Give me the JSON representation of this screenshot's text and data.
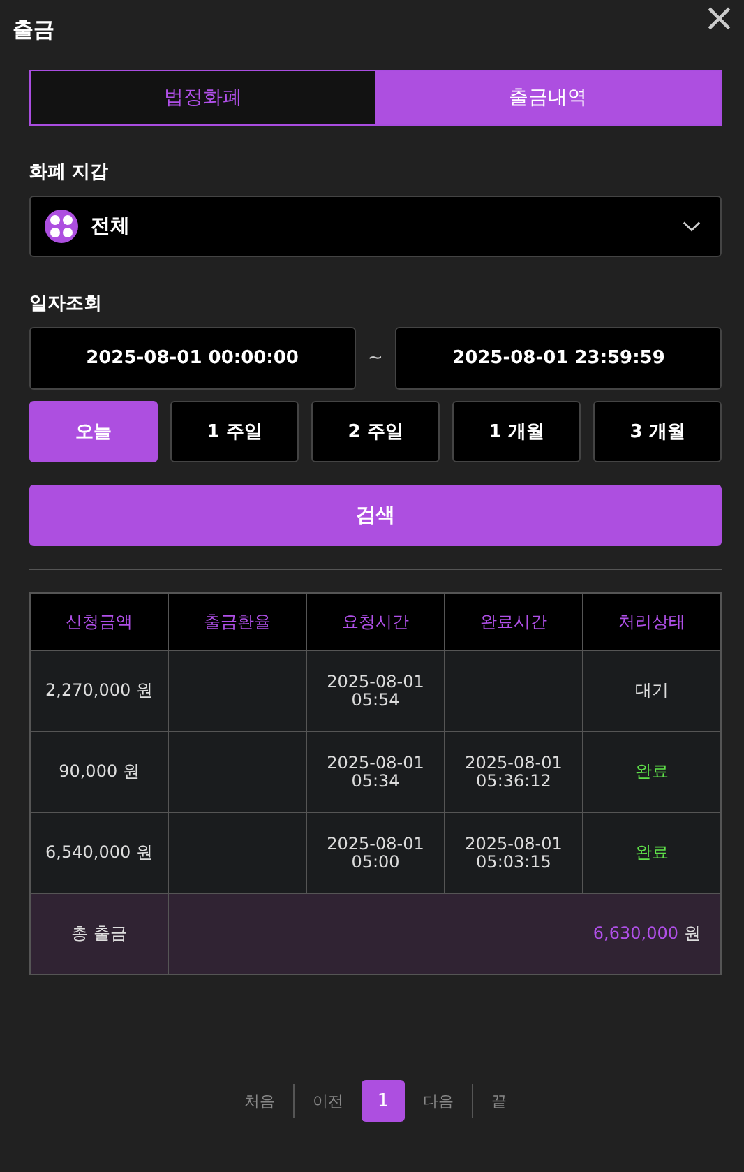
{
  "window": {
    "title": "출금",
    "close": "×"
  },
  "tabs": [
    {
      "label": "법정화폐",
      "selected": false
    },
    {
      "label": "출금내역",
      "selected": true
    }
  ],
  "wallet": {
    "label": "화폐 지갑",
    "value": "전체"
  },
  "date_range": {
    "label": "일자조회",
    "start": "2025-08-01 00:00:00",
    "separator": "~",
    "end": "2025-08-01 23:59:59"
  },
  "periods": [
    {
      "label": "오늘",
      "selected": true
    },
    {
      "label": "1 주일",
      "selected": false
    },
    {
      "label": "2 주일",
      "selected": false
    },
    {
      "label": "1 개월",
      "selected": false
    },
    {
      "label": "3 개월",
      "selected": false
    }
  ],
  "search_button": "검색",
  "table": {
    "columns": [
      "신청금액",
      "출금환율",
      "요청시간",
      "완료시간",
      "처리상태"
    ],
    "rows": [
      {
        "amount": "2,270,000 원",
        "rate": "",
        "requested": [
          "2025-08-01",
          "05:54"
        ],
        "completed": [],
        "status": "대기",
        "kind": "pending"
      },
      {
        "amount": "90,000 원",
        "rate": "",
        "requested": [
          "2025-08-01",
          "05:34"
        ],
        "completed": [
          "2025-08-01",
          "05:36:12"
        ],
        "status": "완료",
        "kind": "done"
      },
      {
        "amount": "6,540,000 원",
        "rate": "",
        "requested": [
          "2025-08-01",
          "05:00"
        ],
        "completed": [
          "2025-08-01",
          "05:03:15"
        ],
        "status": "완료",
        "kind": "done"
      }
    ],
    "total": {
      "label": "총 출금",
      "amount": "6,630,000",
      "unit": "원"
    }
  },
  "pagination": [
    {
      "label": "처음",
      "kind": "text",
      "selected": false
    },
    {
      "label": "이전",
      "kind": "text",
      "selected": false
    },
    {
      "label": "1",
      "kind": "page",
      "selected": true
    },
    {
      "label": "다음",
      "kind": "text",
      "selected": false
    },
    {
      "label": "끝",
      "kind": "text",
      "selected": false
    }
  ]
}
